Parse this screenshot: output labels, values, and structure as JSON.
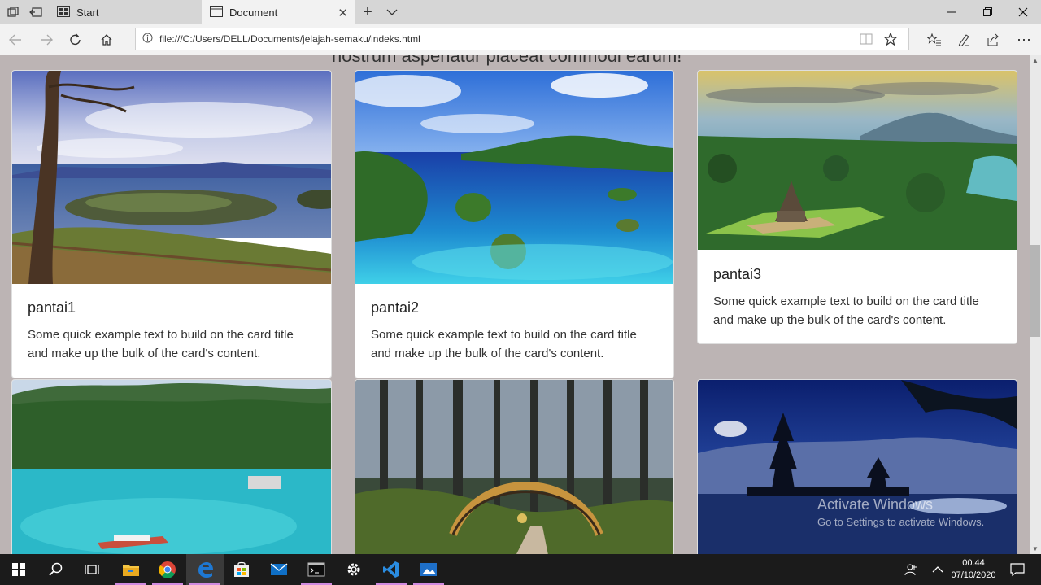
{
  "browser": {
    "tabs": [
      {
        "label": "Start",
        "icon": "start-page-icon"
      },
      {
        "label": "Document",
        "icon": "document-tab-icon"
      }
    ],
    "url": "file:///C:/Users/DELL/Documents/jelajah-semaku/indeks.html"
  },
  "page": {
    "heading_partial": "nostrum asperiatur placeat commodi earum!",
    "cards": [
      {
        "title": "pantai1",
        "text": "Some quick example text to build on the card title and make up the bulk of the card's content."
      },
      {
        "title": "pantai2",
        "text": "Some quick example text to build on the card title and make up the bulk of the card's content."
      },
      {
        "title": "pantai3",
        "text": "Some quick example text to build on the card title and make up the bulk of the card's content."
      }
    ]
  },
  "watermark": {
    "title": "Activate Windows",
    "subtitle": "Go to Settings to activate Windows."
  },
  "taskbar": {
    "time": "00.44",
    "date": "07/10/2020"
  },
  "colors": {
    "page_bg": "#bcb4b4",
    "taskbar_bg": "#1b1b1b",
    "edge_blue": "#1e78d2",
    "vscode_blue": "#2a8ce0"
  }
}
